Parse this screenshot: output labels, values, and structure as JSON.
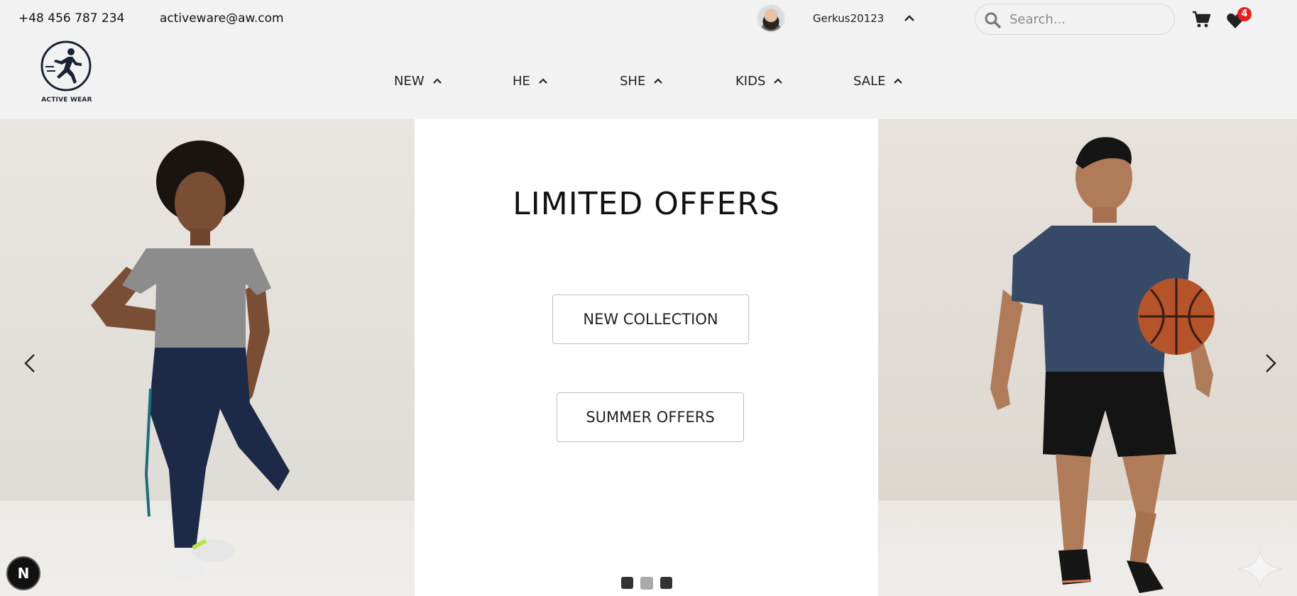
{
  "contact": {
    "phone": "+48 456 787 234",
    "email": "activeware@aw.com"
  },
  "user": {
    "name": "Gerkus20123",
    "avatar": "avatar-photo",
    "menu_icon": "chevron-up-icon"
  },
  "search": {
    "placeholder": "Search..."
  },
  "icons": {
    "search": "search-icon",
    "cart": "cart-icon",
    "wishlist": "heart-icon"
  },
  "wishlist": {
    "count": "4"
  },
  "brand": {
    "name": "ACTIVE WEAR",
    "logo": "runner-logo"
  },
  "nav": {
    "items": [
      {
        "label": "NEW",
        "icon": "chevron-up-icon"
      },
      {
        "label": "HE",
        "icon": "chevron-up-icon"
      },
      {
        "label": "SHE",
        "icon": "chevron-up-icon"
      },
      {
        "label": "KIDS",
        "icon": "chevron-up-icon"
      },
      {
        "label": "SALE",
        "icon": "chevron-up-icon"
      }
    ]
  },
  "hero": {
    "title": "LIMITED OFFERS",
    "buttons": {
      "new_collection": "NEW COLLECTION",
      "summer_offers": "SUMMER OFFERS"
    },
    "slides": {
      "count": 3,
      "active_index": 1
    },
    "prev_icon": "chevron-left-icon",
    "next_icon": "chevron-right-icon",
    "images": [
      "woman-in-activewear-photo",
      "man-with-basketball-photo"
    ]
  },
  "dev_badge": {
    "label": "N"
  },
  "colors": {
    "header_bg": "#f2f2f2",
    "badge": "#e81e1e",
    "text": "#111111",
    "dot_active": "#a9a9a9",
    "dot_inactive": "#333333"
  }
}
